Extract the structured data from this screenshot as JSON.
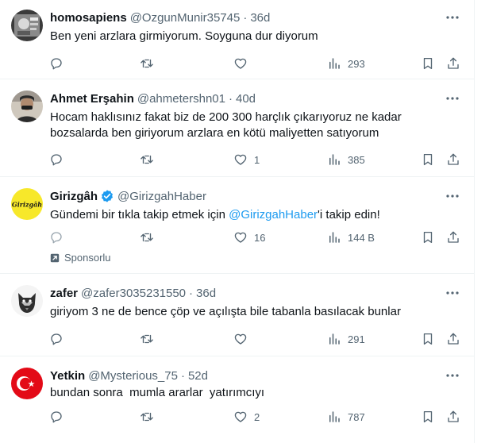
{
  "colors": {
    "accent": "#1d9bf0",
    "muted": "#536471",
    "text": "#0f1419",
    "border": "#eff3f4"
  },
  "tweets": [
    {
      "name": "homosapiens",
      "handle": "@OzgunMunir35745",
      "dot": "·",
      "time": "36d",
      "text": "Ben yeni arzlara girmiyorum. Soyguna dur diyorum",
      "replies": "",
      "retweets": "",
      "likes": "",
      "views": "293"
    },
    {
      "name": "Ahmet Erşahin",
      "handle": "@ahmetershn01",
      "dot": "·",
      "time": "40d",
      "text": "Hocam haklısınız fakat biz de 200 300 harçlık çıkarıyoruz ne kadar bozsalarda ben giriyorum arzlara en kötü maliyetten satıyorum",
      "replies": "",
      "retweets": "",
      "likes": "1",
      "views": "385"
    },
    {
      "name": "Girizgâh",
      "handle": "@GirizgahHaber",
      "avatar_text": "Girizgâh",
      "text_before": "Gündemi bir tıkla takip etmek için ",
      "mention": "@GirizgahHaber",
      "text_after": "'i takip edin!",
      "replies": "",
      "retweets": "",
      "likes": "16",
      "views": "144 B",
      "sponsored": "Sponsorlu"
    },
    {
      "name": "zafer",
      "handle": "@zafer3035231550",
      "dot": "·",
      "time": "36d",
      "text": "giriyom 3 ne de bence çöp ve açılışta bile tabanla basılacak bunlar",
      "replies": "",
      "retweets": "",
      "likes": "",
      "views": "291"
    },
    {
      "name": "Yetkin",
      "handle": "@Mysterious_75",
      "dot": "·",
      "time": "52d",
      "text": "bundan sonra  mumla ararlar  yatırımcıyı",
      "replies": "",
      "retweets": "",
      "likes": "2",
      "views": "787"
    }
  ]
}
